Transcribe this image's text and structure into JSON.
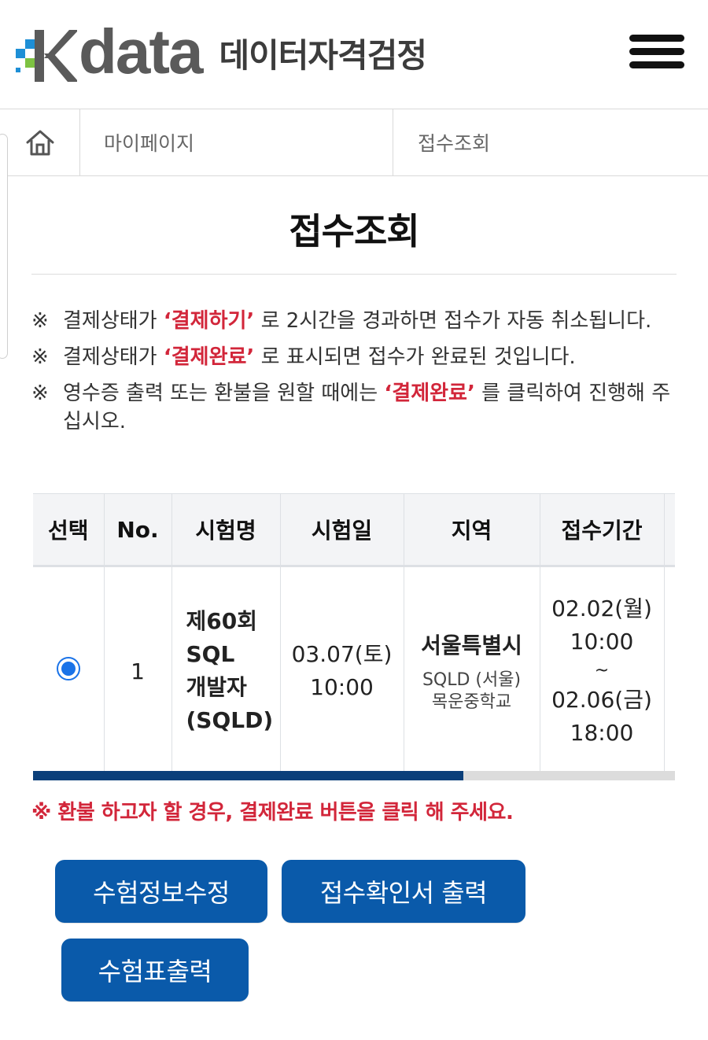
{
  "header": {
    "logo_word": "data",
    "logo_sub": "데이터자격검정",
    "colors": {
      "blue": "#1e8fd6",
      "green": "#7dc242",
      "gray": "#5a5a5a"
    }
  },
  "breadcrumb": {
    "home_icon": "home-icon",
    "items": [
      "마이페이지",
      "접수조회"
    ]
  },
  "page": {
    "title": "접수조회"
  },
  "notices": [
    {
      "mark": "※",
      "before": "결제상태가 ",
      "emphasis": "‘결제하기’",
      "after": " 로 2시간을 경과하면 접수가 자동 취소됩니다."
    },
    {
      "mark": "※",
      "before": "결제상태가 ",
      "emphasis": "‘결제완료’",
      "after": " 로 표시되면 접수가 완료된 것입니다."
    },
    {
      "mark": "※",
      "before": "영수증 출력 또는 환불을 원할 때에는 ",
      "emphasis": "‘결제완료’",
      "after": " 를 클릭하여 진행해 주십시오."
    }
  ],
  "table": {
    "headers": [
      "선택",
      "No.",
      "시험명",
      "시험일",
      "지역",
      "접수기간"
    ],
    "rows": [
      {
        "selected": true,
        "no": "1",
        "exam_name": [
          "제60회",
          "SQL",
          "개발자",
          "(SQLD)"
        ],
        "exam_date": [
          "03.07(토)",
          "10:00"
        ],
        "region_main": "서울특별시",
        "region_sub": [
          "SQLD (서울)",
          "목운중학교"
        ],
        "period": [
          "02.02(월)",
          "10:00",
          "~",
          "02.06(금)",
          "18:00"
        ]
      }
    ],
    "scroll_fraction": 0.67
  },
  "warning": "※ 환불 하고자 할 경우, 결제완료 버튼을 클릭 해 주세요.",
  "buttons": {
    "edit_info": "수험정보수정",
    "print_confirmation": "접수확인서 출력",
    "print_ticket": "수험표출력"
  }
}
